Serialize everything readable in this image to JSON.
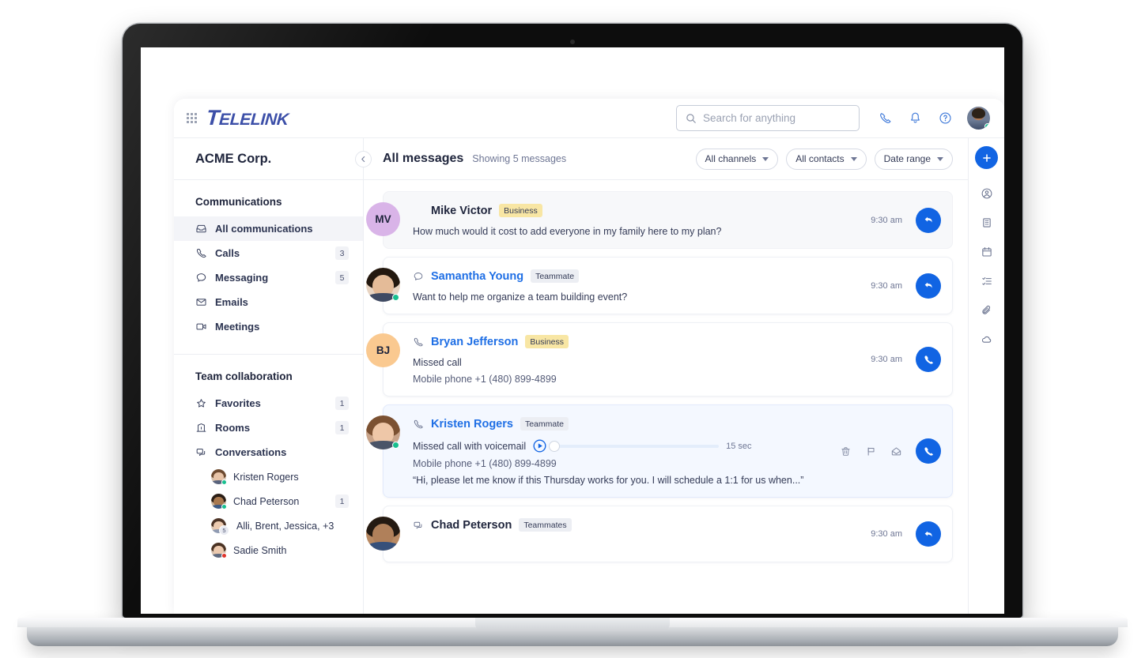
{
  "brand": {
    "logo_cap": "T",
    "logo_rest": "ELELINK",
    "accent_blue": "#1164e3",
    "logo_color": "#3c4fa8",
    "online_green": "#18bf8f",
    "busy_red": "#e0342b",
    "badge_business_bg": "#f8e6a4",
    "badge_team_bg": "#eceef3"
  },
  "topbar": {
    "apps_icon": "grid-apps-icon",
    "search": {
      "placeholder": "Search for anything",
      "value": "",
      "icon": "search-icon"
    },
    "icons": [
      {
        "name": "phone-icon"
      },
      {
        "name": "bell-icon"
      },
      {
        "name": "help-circle-icon"
      }
    ],
    "avatar": {
      "name": "user-avatar",
      "status": "online"
    }
  },
  "sidebar": {
    "org_name": "ACME Corp.",
    "collapse_icon": "chevron-left-icon",
    "sections": [
      {
        "title": "Communications",
        "items": [
          {
            "label": "All communications",
            "icon": "inbox-icon",
            "count": "",
            "active": true
          },
          {
            "label": "Calls",
            "icon": "phone-icon",
            "count": "3",
            "active": false
          },
          {
            "label": "Messaging",
            "icon": "chat-bubble-icon",
            "count": "5",
            "active": false
          },
          {
            "label": "Emails",
            "icon": "envelope-icon",
            "count": "",
            "active": false
          },
          {
            "label": "Meetings",
            "icon": "video-camera-icon",
            "count": "",
            "active": false
          }
        ]
      },
      {
        "title": "Team collaboration",
        "items": [
          {
            "label": "Favorites",
            "icon": "star-icon",
            "count": "1",
            "active": false
          },
          {
            "label": "Rooms",
            "icon": "building-icon",
            "count": "1",
            "active": false
          },
          {
            "label": "Conversations",
            "icon": "conversations-icon",
            "count": "",
            "active": false
          }
        ]
      }
    ],
    "conversations": [
      {
        "label": "Kristen Rogers",
        "count": "",
        "status": "online",
        "group": ""
      },
      {
        "label": "Chad Peterson",
        "count": "1",
        "status": "online",
        "group": ""
      },
      {
        "label": "Alli, Brent, Jessica, +3",
        "count": "",
        "status": "",
        "group": "5"
      },
      {
        "label": "Sadie Smith",
        "count": "",
        "status": "busy",
        "group": ""
      }
    ]
  },
  "main": {
    "title": "All messages",
    "subtitle": "Showing 5 messages",
    "filters": [
      {
        "label": "All channels"
      },
      {
        "label": "All contacts"
      },
      {
        "label": "Date range"
      }
    ],
    "messages": [
      {
        "name": "Mike Victor",
        "name_style": "dark",
        "badge": "Business",
        "badge_type": "biz",
        "channel_icon": "chat-bubble-icon",
        "avatar_initials": "MV",
        "avatar_color": "#d9b4e8",
        "avatar_type": "initials",
        "status": "",
        "lines": [
          "How much would it cost to add everyone in my family here to my plan?"
        ],
        "time": "9:30 am",
        "action_icon": "reply-icon",
        "state": "read",
        "voicemail": null
      },
      {
        "name": "Samantha Young",
        "name_style": "link",
        "badge": "Teammate",
        "badge_type": "team",
        "channel_icon": "chat-bubble-icon",
        "avatar_initials": "",
        "avatar_color": "#e8d4c2",
        "avatar_type": "photo",
        "status": "online",
        "lines": [
          "Want to help me organize a team building event?"
        ],
        "time": "9:30 am",
        "action_icon": "reply-icon",
        "state": "normal",
        "voicemail": null
      },
      {
        "name": "Bryan Jefferson",
        "name_style": "link",
        "badge": "Business",
        "badge_type": "biz",
        "channel_icon": "phone-icon",
        "avatar_initials": "BJ",
        "avatar_color": "#fac990",
        "avatar_type": "initials",
        "status": "",
        "lines": [
          "Missed call",
          "Mobile phone +1 (480) 899-4899"
        ],
        "time": "9:30 am",
        "action_icon": "phone-icon",
        "state": "normal",
        "voicemail": null
      },
      {
        "name": "Kristen Rogers",
        "name_style": "link",
        "badge": "Teammate",
        "badge_type": "team",
        "channel_icon": "phone-icon",
        "avatar_initials": "",
        "avatar_color": "#c9a48a",
        "avatar_type": "photo",
        "status": "online",
        "lines": [
          "Mobile phone +1 (480) 899-4899",
          "“Hi, please let me know if this Thursday works for you. I will schedule a 1:1 for us when...”"
        ],
        "time": "",
        "action_icon": "phone-icon",
        "state": "sel",
        "voicemail": {
          "label": "Missed call with voicemail",
          "duration": "15 sec",
          "play_icon": "play-circle-icon",
          "progress": 0,
          "actions": [
            {
              "name": "trash-icon"
            },
            {
              "name": "flag-icon"
            },
            {
              "name": "mark-unread-icon"
            }
          ]
        }
      },
      {
        "name": "Chad Peterson",
        "name_style": "dark",
        "badge": "Teammates",
        "badge_type": "team",
        "channel_icon": "conversations-icon",
        "avatar_initials": "",
        "avatar_color": "#b98a63",
        "avatar_type": "photo",
        "status": "",
        "lines": [],
        "time": "9:30 am",
        "action_icon": "reply-icon",
        "state": "normal",
        "voicemail": null
      }
    ]
  },
  "rail": {
    "fab": {
      "name": "add-button",
      "icon": "plus-icon"
    },
    "icons": [
      {
        "name": "contact-icon"
      },
      {
        "name": "building-icon"
      },
      {
        "name": "calendar-icon"
      },
      {
        "name": "task-list-icon"
      },
      {
        "name": "paperclip-icon"
      },
      {
        "name": "cloud-icon"
      }
    ]
  }
}
